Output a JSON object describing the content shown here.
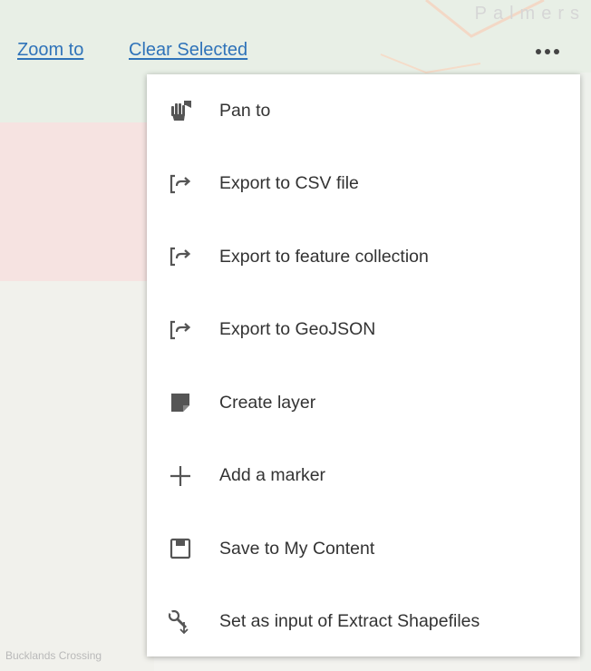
{
  "map": {
    "place_label_top": "Palmers",
    "place_label_bottom": "Bucklands Crossing"
  },
  "toolbar": {
    "zoom_to_label": "Zoom to",
    "clear_selected_label": "Clear Selected",
    "more_icon": "more-horizontal-icon",
    "link_color": "#2f73b9"
  },
  "menu": {
    "items": [
      {
        "label": "Pan to",
        "icon": "pan-icon"
      },
      {
        "label": "Export to CSV file",
        "icon": "export-icon"
      },
      {
        "label": "Export to feature collection",
        "icon": "export-icon"
      },
      {
        "label": "Export to GeoJSON",
        "icon": "export-icon"
      },
      {
        "label": "Create layer",
        "icon": "layer-icon"
      },
      {
        "label": "Add a marker",
        "icon": "plus-icon"
      },
      {
        "label": "Save to My Content",
        "icon": "save-icon"
      },
      {
        "label": "Set as input of Extract Shapefiles",
        "icon": "wrench-icon"
      }
    ]
  }
}
